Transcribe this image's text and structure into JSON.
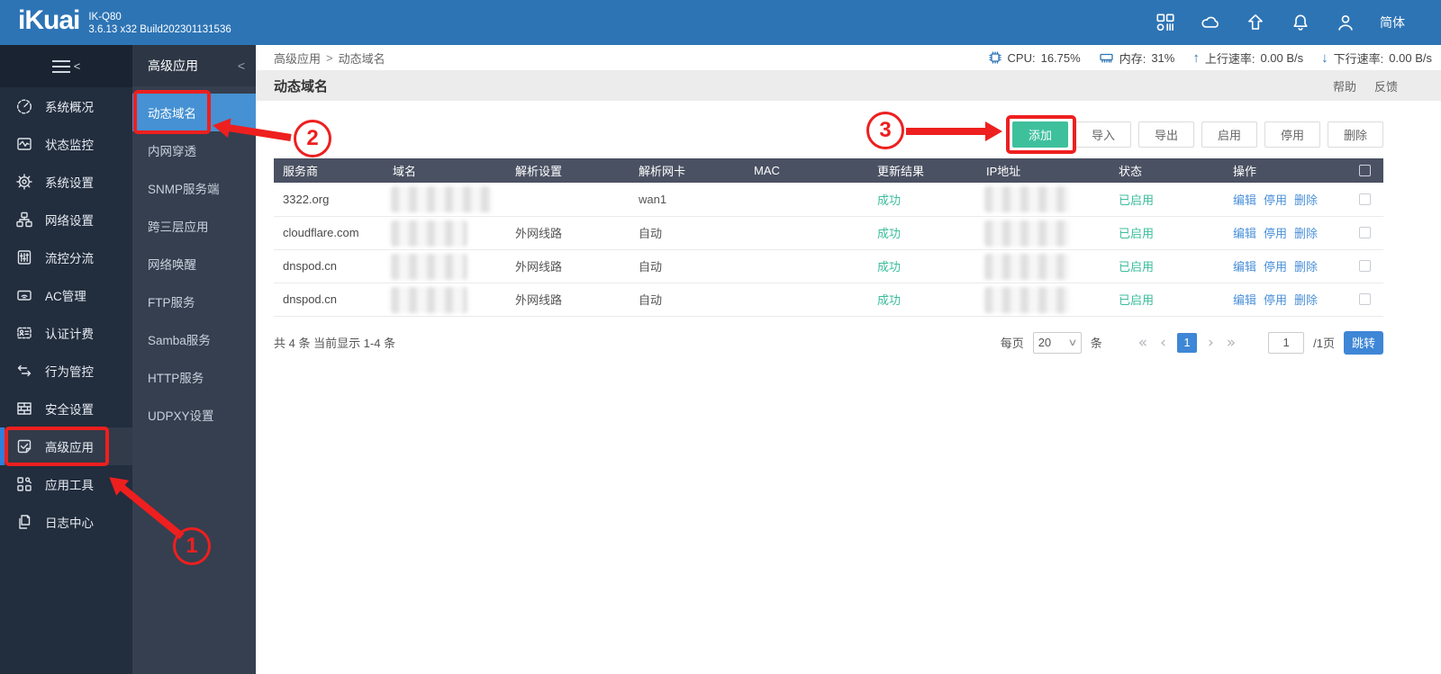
{
  "topbar": {
    "logo": "iKuai",
    "model": "IK-Q80",
    "build": "3.6.13 x32 Build202301131536",
    "language": "简体"
  },
  "icons": {
    "collapse_left": "<",
    "chevron_down": "∨",
    "up_arrow": "↑",
    "down_arrow": "↓"
  },
  "sidebar": {
    "items": [
      {
        "label": "系统概况"
      },
      {
        "label": "状态监控"
      },
      {
        "label": "系统设置"
      },
      {
        "label": "网络设置"
      },
      {
        "label": "流控分流"
      },
      {
        "label": "AC管理"
      },
      {
        "label": "认证计费"
      },
      {
        "label": "行为管控"
      },
      {
        "label": "安全设置"
      },
      {
        "label": "高级应用"
      },
      {
        "label": "应用工具"
      },
      {
        "label": "日志中心"
      }
    ]
  },
  "submenu": {
    "title": "高级应用",
    "items": [
      "动态域名",
      "内网穿透",
      "SNMP服务端",
      "跨三层应用",
      "网络唤醒",
      "FTP服务",
      "Samba服务",
      "HTTP服务",
      "UDPXY设置"
    ]
  },
  "breadcrumb": {
    "section": "高级应用",
    "sep": ">",
    "current": "动态域名"
  },
  "stats": {
    "cpu_label": "CPU:",
    "cpu_value": "16.75%",
    "mem_label": "内存:",
    "mem_value": "31%",
    "up_label": "上行速率:",
    "up_value": "0.00 B/s",
    "down_label": "下行速率:",
    "down_value": "0.00 B/s"
  },
  "page": {
    "title": "动态域名",
    "help_label": "帮助",
    "feedback_label": "反馈"
  },
  "toolbar": {
    "add_label": "添加",
    "import_label": "导入",
    "export_label": "导出",
    "enable_label": "启用",
    "disable_label": "停用",
    "delete_label": "删除"
  },
  "table": {
    "headers": [
      "服务商",
      "域名",
      "解析设置",
      "解析网卡",
      "MAC",
      "更新结果",
      "IP地址",
      "状态",
      "操作"
    ],
    "action_labels": [
      "编辑",
      "停用",
      "删除"
    ],
    "rows": [
      {
        "provider": "3322.org",
        "domain_blurred": true,
        "resolve": "",
        "nic": "wan1",
        "mac": "",
        "result": "成功",
        "ip_blurred": true,
        "status": "已启用"
      },
      {
        "provider": "cloudflare.com",
        "domain_blurred": true,
        "resolve": "外网线路",
        "nic": "自动",
        "mac": "",
        "result": "成功",
        "ip_blurred": true,
        "status": "已启用"
      },
      {
        "provider": "dnspod.cn",
        "domain_blurred": true,
        "resolve": "外网线路",
        "nic": "自动",
        "mac": "",
        "result": "成功",
        "ip_blurred": true,
        "status": "已启用"
      },
      {
        "provider": "dnspod.cn",
        "domain_blurred": true,
        "resolve": "外网线路",
        "nic": "自动",
        "mac": "",
        "result": "成功",
        "ip_blurred": true,
        "status": "已启用"
      }
    ]
  },
  "pagination": {
    "summary": "共 4 条 当前显示 1-4 条",
    "per_page_label": "每页",
    "per_page_value": "20",
    "unit_label": "条",
    "first_icon": "«",
    "prev_icon": "‹",
    "current_page": "1",
    "next_icon": "›",
    "last_icon": "»",
    "jump_input_value": "1",
    "total_pages_label": "/1页",
    "jump_button_label": "跳转"
  },
  "annotations": {
    "step1": "1",
    "step2": "2",
    "step3": "3"
  },
  "colors": {
    "topbar_blue": "#2d74b5",
    "accent_blue": "#3e86d6",
    "selected_blue": "#4591d3",
    "green": "#3ec09d",
    "link_blue": "#4a90d9",
    "table_header": "#4a5162",
    "annotation_red": "#ee1f1f"
  }
}
